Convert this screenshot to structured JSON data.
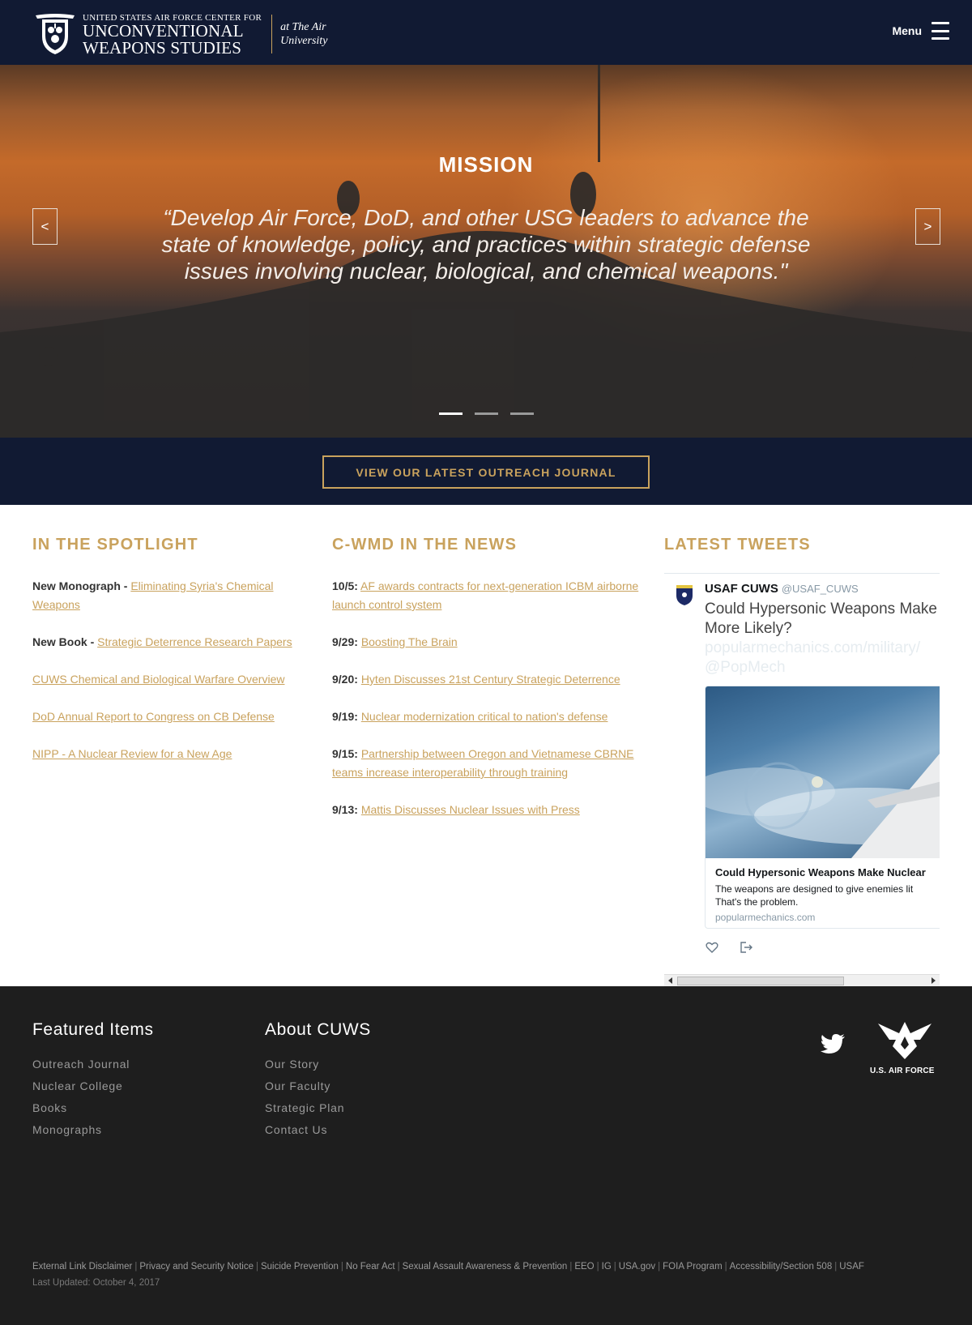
{
  "header": {
    "logo_top": "UNITED STATES AIR FORCE CENTER FOR",
    "logo_line1": "UNCONVENTIONAL",
    "logo_line2": "WEAPONS STUDIES",
    "logo_sub_line1": "at The Air",
    "logo_sub_line2": "University",
    "menu_label": "Menu"
  },
  "hero": {
    "title": "MISSION",
    "quote": "“Develop Air Force, DoD, and other USG leaders to advance the state of knowledge, policy, and practices within strategic defense issues involving nuclear, biological, and chemical weapons.\"",
    "prev_label": "<",
    "next_label": ">",
    "slides_count": 3,
    "active_slide": 1
  },
  "journal_button": "VIEW OUR LATEST OUTREACH JOURNAL",
  "spotlight": {
    "heading": "IN THE SPOTLIGHT",
    "items": [
      {
        "prefix": "New Monograph - ",
        "link": "Eliminating Syria's Chemical Weapons"
      },
      {
        "prefix": "New Book - ",
        "link": "Strategic Deterrence Research Papers"
      },
      {
        "prefix": "",
        "link": "CUWS Chemical and Biological Warfare Overview"
      },
      {
        "prefix": "",
        "link": "DoD Annual Report to Congress on CB Defense"
      },
      {
        "prefix": "",
        "link": "NIPP - A Nuclear Review for a New Age"
      }
    ]
  },
  "news": {
    "heading": "C-WMD IN THE NEWS",
    "items": [
      {
        "date": "10/5:",
        "link": "AF awards contracts for next-generation ICBM airborne launch control system"
      },
      {
        "date": "9/29:",
        "link": "Boosting The Brain"
      },
      {
        "date": "9/20:",
        "link": "Hyten Discusses 21st Century Strategic Deterrence"
      },
      {
        "date": "9/19:",
        "link": "Nuclear modernization critical to nation's defense"
      },
      {
        "date": "9/15:",
        "link": "Partnership between Oregon and Vietnamese CBRNE teams increase interoperability through training"
      },
      {
        "date": "9/13:",
        "link": "Mattis Discusses Nuclear Issues with Press"
      }
    ]
  },
  "tweets": {
    "heading": "LATEST TWEETS",
    "name": "USAF CUWS",
    "handle": "@USAF_CUWS",
    "text_line1": "Could Hypersonic Weapons Make",
    "text_line2": "More Likely?",
    "text_link": "popularmechanics.com/military/",
    "text_mention": "@PopMech",
    "card_title": "Could Hypersonic Weapons Make Nuclear",
    "card_desc_line1": "The weapons are designed to give enemies lit",
    "card_desc_line2": "That's the problem.",
    "card_url": "popularmechanics.com"
  },
  "footer": {
    "featured_heading": "Featured Items",
    "featured_links": [
      "Outreach Journal",
      "Nuclear College",
      "Books",
      "Monographs"
    ],
    "about_heading": "About CUWS",
    "about_links": [
      "Our Story",
      "Our Faculty",
      "Strategic Plan",
      "Contact Us"
    ],
    "usaf_label": "U.S. AIR FORCE",
    "legal_links": [
      "External Link Disclaimer",
      "Privacy and Security Notice",
      "Suicide Prevention",
      "No Fear Act",
      "Sexual Assault Awareness & Prevention",
      "EEO",
      "IG",
      "USA.gov",
      "FOIA Program",
      "Accessibility/Section 508",
      "USAF"
    ],
    "last_updated": "Last Updated: October 4, 2017"
  },
  "colors": {
    "navy": "#111a33",
    "gold": "#c9a25d",
    "footer_bg": "#1e1e1e"
  }
}
